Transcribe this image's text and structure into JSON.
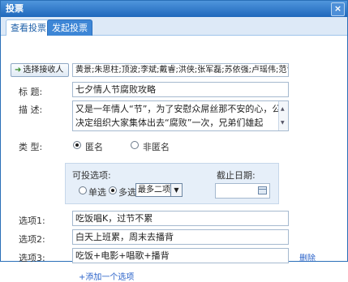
{
  "window": {
    "title": "投票",
    "close_glyph": "×"
  },
  "tabs": [
    {
      "label": "查看投票",
      "active": false
    },
    {
      "label": "发起投票",
      "active": true
    }
  ],
  "form": {
    "select_button_label": "选择接收人",
    "recipients_value": "黄景;朱思柱;顶波;李斌;戴睿;洪侠;张军磊;苏依强;卢瑶伟;范青;",
    "title_label": "标  题:",
    "title_value": "七夕情人节腐败攻略",
    "description_label": "描  述:",
    "description_line1": "又是一年情人“节”，为了安慰众屌丝那不安的心，公司",
    "description_line2": "决定组织大家集体出去“腐败”一次，兄弟们雄起",
    "type_label": "类  型:",
    "type_options": [
      {
        "label": "匿名",
        "selected": true
      },
      {
        "label": "非匿名",
        "selected": false
      }
    ],
    "selectable_label": "可投选项:",
    "choice_modes": [
      {
        "label": "单选",
        "selected": false
      },
      {
        "label": "多选",
        "selected": true
      }
    ],
    "max_select_value": "最多二项",
    "deadline_label": "截止日期:",
    "deadline_value": "",
    "options": [
      {
        "label": "选项1:",
        "value": "吃饭唱K，过节不累"
      },
      {
        "label": "选项2:",
        "value": "白天上班累，周末去播背"
      },
      {
        "label": "选项3:",
        "value": "吃饭+电影+唱歌+播背"
      }
    ],
    "delete_label": "删除",
    "add_option_label": "+添加一个选项"
  }
}
